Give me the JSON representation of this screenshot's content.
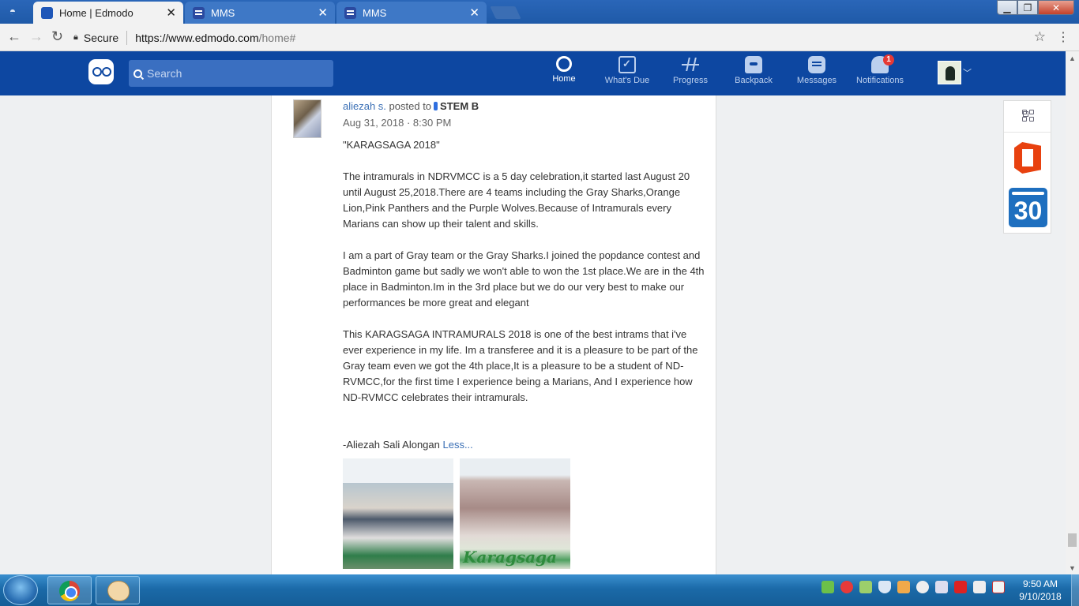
{
  "browser": {
    "tabs": [
      {
        "title": "Home | Edmodo",
        "active": true
      },
      {
        "title": "MMS",
        "active": false
      },
      {
        "title": "MMS",
        "active": false
      }
    ],
    "secure_label": "Secure",
    "url_host": "https://www.edmodo.com",
    "url_path": "/home#"
  },
  "header": {
    "search_placeholder": "Search",
    "nav": [
      {
        "label": "Home",
        "icon": "home-icon",
        "active": true
      },
      {
        "label": "What's Due",
        "icon": "calendar-check-icon",
        "active": false
      },
      {
        "label": "Progress",
        "icon": "pulse-icon",
        "active": false
      },
      {
        "label": "Backpack",
        "icon": "backpack-icon",
        "active": false
      },
      {
        "label": "Messages",
        "icon": "chat-icon",
        "active": false
      },
      {
        "label": "Notifications",
        "icon": "bell-icon",
        "active": false
      }
    ],
    "notification_count": "1",
    "accent_color": "#0d47a1"
  },
  "post": {
    "author": "aliezah s.",
    "posted_to": "posted to",
    "group": "STEM B",
    "date": "Aug 31, 2018 · 8:30 PM",
    "title": "\"KARAGSAGA 2018\"",
    "para1": "The intramurals in NDRVMCC is a 5 day celebration,it started last August 20 until August 25,2018.There are 4 teams including the Gray Sharks,Orange Lion,Pink Panthers and the Purple Wolves.Because of Intramurals every Marians can show up their talent and skills.",
    "para2": "I am a part of Gray team or the Gray Sharks.I joined the popdance contest and Badminton game but sadly we won't able to won the 1st place.We are in the 4th place in Badminton.Im in the 3rd place but we do our very best to make our performances be more great and elegant",
    "para3": "This KARAGSAGA INTRAMURALS 2018 is one of the best intrams that i've ever experience in my life. Im a transferee and it is a pleasure to be part of the Gray team even we got the 4th place,It is a pleasure to be a student of ND-RVMCC,for the first time I experience being a Marians, And I experience how ND-RVMCC celebrates their intramurals.",
    "signature": "-Aliezah Sali Alongan",
    "less_link": "Less...",
    "image2_text": "Karagsaga"
  },
  "widgets": {
    "calendar_day": "30"
  },
  "taskbar": {
    "time": "9:50 AM",
    "date": "9/10/2018"
  }
}
